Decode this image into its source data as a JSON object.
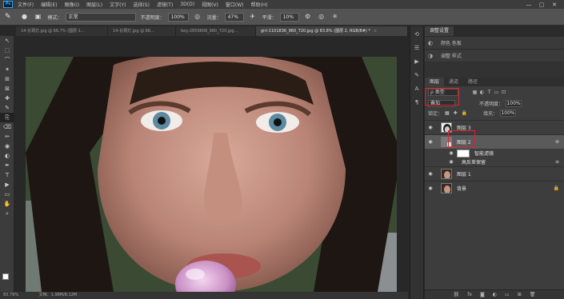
{
  "menu": {
    "logo": "Ps",
    "items": [
      "文件(F)",
      "编辑(E)",
      "图像(I)",
      "图层(L)",
      "文字(Y)",
      "选择(S)",
      "滤镜(T)",
      "3D(D)",
      "视图(V)",
      "窗口(W)",
      "帮助(H)"
    ],
    "window_controls": [
      "—",
      "▢",
      "✕"
    ]
  },
  "options": {
    "mode_label": "模式：",
    "mode_value": "正常",
    "opacity_label": "不透明度：",
    "opacity_value": "100%",
    "flow_label": "流量：",
    "flow_value": "47%",
    "smooth_label": "平滑：",
    "smooth_value": "10%"
  },
  "tabs": [
    {
      "label": "14-长颈灯.jpg @ 66.7% (图层 1...",
      "active": false
    },
    {
      "label": "14-长颈灯.jpg @ 66...",
      "active": false
    },
    {
      "label": "boy-2659808_960_720.jpg...",
      "active": false
    },
    {
      "label": "girl-1101836_960_720.jpg @ 83.8% (图层 2, RGB/8#) *",
      "active": true
    }
  ],
  "tools": [
    "↖",
    "⬚",
    "⌒",
    "✶",
    "⊞",
    "⊠",
    "✚",
    "✎",
    "⎘",
    "⌫",
    "✏",
    "◉",
    "◐",
    "✒",
    "T",
    "▶",
    "▭",
    "✋",
    "⌕"
  ],
  "status": {
    "zoom": "83.79%",
    "doc": "文档：1.98M/8.12M"
  },
  "adjust_panel": {
    "tabs": [
      "调整设置"
    ],
    "rows": [
      {
        "icon": "color-icon",
        "label": "颜色  色板"
      },
      {
        "icon": "adjust-icon",
        "label": "调整  样式"
      }
    ]
  },
  "layers_panel": {
    "tabs": [
      "图层",
      "通道",
      "路径"
    ],
    "kind": "ρ 类型",
    "blend_mode": "叠加",
    "opacity_label": "不透明度：",
    "opacity_value": "100%",
    "lock_label": "锁定：",
    "fill_label": "填充：",
    "fill_value": "100%",
    "layers": [
      {
        "name": "图层 3",
        "selected": false
      },
      {
        "name": "图层 2",
        "selected": true
      },
      {
        "name": "智能滤镜",
        "sub": true
      },
      {
        "name": "高反差保留",
        "sub": true
      },
      {
        "name": "图层 1",
        "selected": false
      },
      {
        "name": "背景",
        "selected": false
      }
    ]
  }
}
